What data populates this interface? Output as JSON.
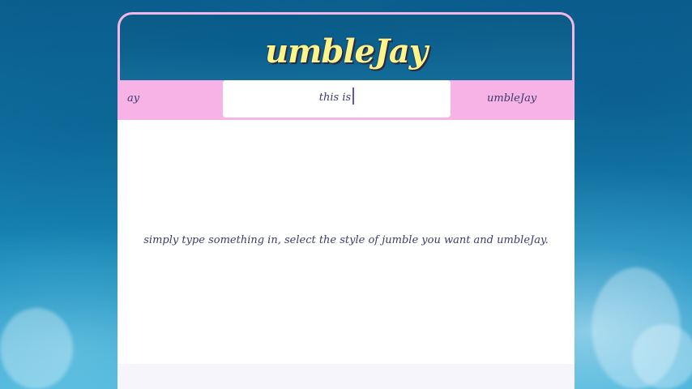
{
  "app": {
    "title": "umbleJay"
  },
  "toolbar": {
    "left_label": "ay",
    "input_value": "this is",
    "right_label": "umbleJay"
  },
  "content": {
    "message": "simply type something in, select the style of jumble you want and umbleJay."
  },
  "colors": {
    "accent_pink": "#f7b2e6",
    "logo_yellow": "#fdf48a",
    "text_navy": "#3b3b6e",
    "caret": "#5656c9"
  }
}
